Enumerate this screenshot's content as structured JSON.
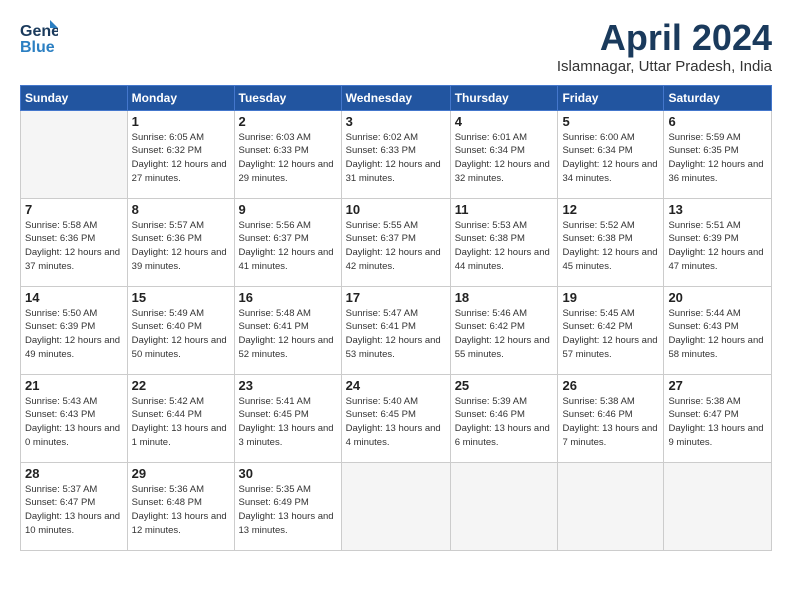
{
  "header": {
    "logo_line1": "General",
    "logo_line2": "Blue",
    "month": "April 2024",
    "location": "Islamnagar, Uttar Pradesh, India"
  },
  "weekdays": [
    "Sunday",
    "Monday",
    "Tuesday",
    "Wednesday",
    "Thursday",
    "Friday",
    "Saturday"
  ],
  "weeks": [
    [
      {
        "day": "",
        "info": ""
      },
      {
        "day": "1",
        "info": "Sunrise: 6:05 AM\nSunset: 6:32 PM\nDaylight: 12 hours\nand 27 minutes."
      },
      {
        "day": "2",
        "info": "Sunrise: 6:03 AM\nSunset: 6:33 PM\nDaylight: 12 hours\nand 29 minutes."
      },
      {
        "day": "3",
        "info": "Sunrise: 6:02 AM\nSunset: 6:33 PM\nDaylight: 12 hours\nand 31 minutes."
      },
      {
        "day": "4",
        "info": "Sunrise: 6:01 AM\nSunset: 6:34 PM\nDaylight: 12 hours\nand 32 minutes."
      },
      {
        "day": "5",
        "info": "Sunrise: 6:00 AM\nSunset: 6:34 PM\nDaylight: 12 hours\nand 34 minutes."
      },
      {
        "day": "6",
        "info": "Sunrise: 5:59 AM\nSunset: 6:35 PM\nDaylight: 12 hours\nand 36 minutes."
      }
    ],
    [
      {
        "day": "7",
        "info": "Sunrise: 5:58 AM\nSunset: 6:36 PM\nDaylight: 12 hours\nand 37 minutes."
      },
      {
        "day": "8",
        "info": "Sunrise: 5:57 AM\nSunset: 6:36 PM\nDaylight: 12 hours\nand 39 minutes."
      },
      {
        "day": "9",
        "info": "Sunrise: 5:56 AM\nSunset: 6:37 PM\nDaylight: 12 hours\nand 41 minutes."
      },
      {
        "day": "10",
        "info": "Sunrise: 5:55 AM\nSunset: 6:37 PM\nDaylight: 12 hours\nand 42 minutes."
      },
      {
        "day": "11",
        "info": "Sunrise: 5:53 AM\nSunset: 6:38 PM\nDaylight: 12 hours\nand 44 minutes."
      },
      {
        "day": "12",
        "info": "Sunrise: 5:52 AM\nSunset: 6:38 PM\nDaylight: 12 hours\nand 45 minutes."
      },
      {
        "day": "13",
        "info": "Sunrise: 5:51 AM\nSunset: 6:39 PM\nDaylight: 12 hours\nand 47 minutes."
      }
    ],
    [
      {
        "day": "14",
        "info": "Sunrise: 5:50 AM\nSunset: 6:39 PM\nDaylight: 12 hours\nand 49 minutes."
      },
      {
        "day": "15",
        "info": "Sunrise: 5:49 AM\nSunset: 6:40 PM\nDaylight: 12 hours\nand 50 minutes."
      },
      {
        "day": "16",
        "info": "Sunrise: 5:48 AM\nSunset: 6:41 PM\nDaylight: 12 hours\nand 52 minutes."
      },
      {
        "day": "17",
        "info": "Sunrise: 5:47 AM\nSunset: 6:41 PM\nDaylight: 12 hours\nand 53 minutes."
      },
      {
        "day": "18",
        "info": "Sunrise: 5:46 AM\nSunset: 6:42 PM\nDaylight: 12 hours\nand 55 minutes."
      },
      {
        "day": "19",
        "info": "Sunrise: 5:45 AM\nSunset: 6:42 PM\nDaylight: 12 hours\nand 57 minutes."
      },
      {
        "day": "20",
        "info": "Sunrise: 5:44 AM\nSunset: 6:43 PM\nDaylight: 12 hours\nand 58 minutes."
      }
    ],
    [
      {
        "day": "21",
        "info": "Sunrise: 5:43 AM\nSunset: 6:43 PM\nDaylight: 13 hours\nand 0 minutes."
      },
      {
        "day": "22",
        "info": "Sunrise: 5:42 AM\nSunset: 6:44 PM\nDaylight: 13 hours\nand 1 minute."
      },
      {
        "day": "23",
        "info": "Sunrise: 5:41 AM\nSunset: 6:45 PM\nDaylight: 13 hours\nand 3 minutes."
      },
      {
        "day": "24",
        "info": "Sunrise: 5:40 AM\nSunset: 6:45 PM\nDaylight: 13 hours\nand 4 minutes."
      },
      {
        "day": "25",
        "info": "Sunrise: 5:39 AM\nSunset: 6:46 PM\nDaylight: 13 hours\nand 6 minutes."
      },
      {
        "day": "26",
        "info": "Sunrise: 5:38 AM\nSunset: 6:46 PM\nDaylight: 13 hours\nand 7 minutes."
      },
      {
        "day": "27",
        "info": "Sunrise: 5:38 AM\nSunset: 6:47 PM\nDaylight: 13 hours\nand 9 minutes."
      }
    ],
    [
      {
        "day": "28",
        "info": "Sunrise: 5:37 AM\nSunset: 6:47 PM\nDaylight: 13 hours\nand 10 minutes."
      },
      {
        "day": "29",
        "info": "Sunrise: 5:36 AM\nSunset: 6:48 PM\nDaylight: 13 hours\nand 12 minutes."
      },
      {
        "day": "30",
        "info": "Sunrise: 5:35 AM\nSunset: 6:49 PM\nDaylight: 13 hours\nand 13 minutes."
      },
      {
        "day": "",
        "info": ""
      },
      {
        "day": "",
        "info": ""
      },
      {
        "day": "",
        "info": ""
      },
      {
        "day": "",
        "info": ""
      }
    ]
  ]
}
